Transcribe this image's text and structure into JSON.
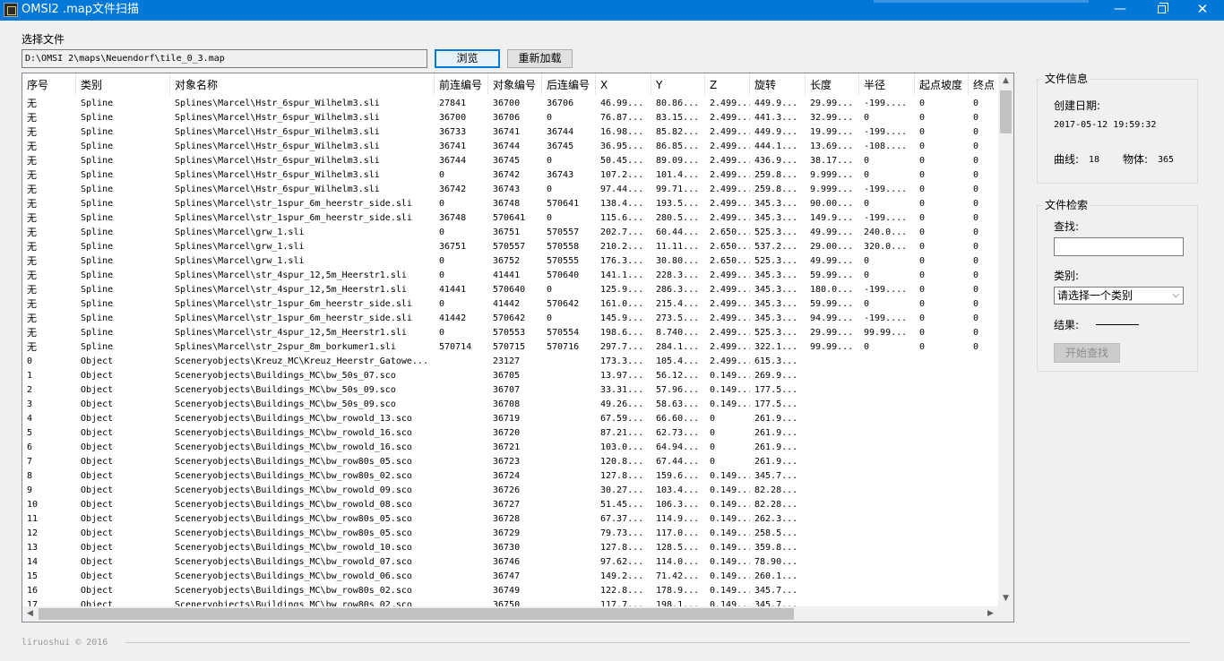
{
  "window": {
    "title": "OMSI2 .map文件扫描",
    "minimize": "—",
    "close": "✕"
  },
  "file": {
    "label": "选择文件",
    "path": "D:\\OMSI 2\\maps\\Neuendorf\\tile_0_3.map",
    "browse_label": "浏览",
    "reload_label": "重新加载"
  },
  "table": {
    "columns": [
      "序号",
      "类别",
      "对象名称",
      "前连编号",
      "对象编号",
      "后连编号",
      "X",
      "Y",
      "Z",
      "旋转",
      "长度",
      "半径",
      "起点坡度",
      "终点"
    ],
    "rows": [
      [
        "无",
        "Spline",
        "Splines\\Marcel\\Hstr_6spur_Wilhelm3.sli",
        "27841",
        "36700",
        "36706",
        "46.99...",
        "80.86...",
        "2.499...",
        "449.9...",
        "29.99...",
        "-199....",
        "0",
        "0"
      ],
      [
        "无",
        "Spline",
        "Splines\\Marcel\\Hstr_6spur_Wilhelm3.sli",
        "36700",
        "36706",
        "0",
        "76.87...",
        "83.15...",
        "2.499...",
        "441.3...",
        "32.99...",
        "0",
        "0",
        "0"
      ],
      [
        "无",
        "Spline",
        "Splines\\Marcel\\Hstr_6spur_Wilhelm3.sli",
        "36733",
        "36741",
        "36744",
        "16.98...",
        "85.82...",
        "2.499...",
        "449.9...",
        "19.99...",
        "-199....",
        "0",
        "0"
      ],
      [
        "无",
        "Spline",
        "Splines\\Marcel\\Hstr_6spur_Wilhelm3.sli",
        "36741",
        "36744",
        "36745",
        "36.95...",
        "86.85...",
        "2.499...",
        "444.1...",
        "13.69...",
        "-108....",
        "0",
        "0"
      ],
      [
        "无",
        "Spline",
        "Splines\\Marcel\\Hstr_6spur_Wilhelm3.sli",
        "36744",
        "36745",
        "0",
        "50.45...",
        "89.09...",
        "2.499...",
        "436.9...",
        "38.17...",
        "0",
        "0",
        "0"
      ],
      [
        "无",
        "Spline",
        "Splines\\Marcel\\Hstr_6spur_Wilhelm3.sli",
        "0",
        "36742",
        "36743",
        "107.2...",
        "101.4...",
        "2.499...",
        "259.8...",
        "9.999...",
        "0",
        "0",
        "0"
      ],
      [
        "无",
        "Spline",
        "Splines\\Marcel\\Hstr_6spur_Wilhelm3.sli",
        "36742",
        "36743",
        "0",
        "97.44...",
        "99.71...",
        "2.499...",
        "259.8...",
        "9.999...",
        "-199....",
        "0",
        "0"
      ],
      [
        "无",
        "Spline",
        "Splines\\Marcel\\str_1spur_6m_heerstr_side.sli",
        "0",
        "36748",
        "570641",
        "138.4...",
        "193.5...",
        "2.499...",
        "345.3...",
        "90.00...",
        "0",
        "0",
        "0"
      ],
      [
        "无",
        "Spline",
        "Splines\\Marcel\\str_1spur_6m_heerstr_side.sli",
        "36748",
        "570641",
        "0",
        "115.6...",
        "280.5...",
        "2.499...",
        "345.3...",
        "149.9...",
        "-199....",
        "0",
        "0"
      ],
      [
        "无",
        "Spline",
        "Splines\\Marcel\\grw_1.sli",
        "0",
        "36751",
        "570557",
        "202.7...",
        "60.44...",
        "2.650...",
        "525.3...",
        "49.99...",
        "240.0...",
        "0",
        "0"
      ],
      [
        "无",
        "Spline",
        "Splines\\Marcel\\grw_1.sli",
        "36751",
        "570557",
        "570558",
        "210.2...",
        "11.11...",
        "2.650...",
        "537.2...",
        "29.00...",
        "320.0...",
        "0",
        "0"
      ],
      [
        "无",
        "Spline",
        "Splines\\Marcel\\grw_1.sli",
        "0",
        "36752",
        "570555",
        "176.3...",
        "30.80...",
        "2.650...",
        "525.3...",
        "49.99...",
        "0",
        "0",
        "0"
      ],
      [
        "无",
        "Spline",
        "Splines\\Marcel\\str_4spur_12,5m_Heerstr1.sli",
        "0",
        "41441",
        "570640",
        "141.1...",
        "228.3...",
        "2.499...",
        "345.3...",
        "59.99...",
        "0",
        "0",
        "0"
      ],
      [
        "无",
        "Spline",
        "Splines\\Marcel\\str_4spur_12,5m_Heerstr1.sli",
        "41441",
        "570640",
        "0",
        "125.9...",
        "286.3...",
        "2.499...",
        "345.3...",
        "180.0...",
        "-199....",
        "0",
        "0"
      ],
      [
        "无",
        "Spline",
        "Splines\\Marcel\\str_1spur_6m_heerstr_side.sli",
        "0",
        "41442",
        "570642",
        "161.0...",
        "215.4...",
        "2.499...",
        "345.3...",
        "59.99...",
        "0",
        "0",
        "0"
      ],
      [
        "无",
        "Spline",
        "Splines\\Marcel\\str_1spur_6m_heerstr_side.sli",
        "41442",
        "570642",
        "0",
        "145.9...",
        "273.5...",
        "2.499...",
        "345.3...",
        "94.99...",
        "-199....",
        "0",
        "0"
      ],
      [
        "无",
        "Spline",
        "Splines\\Marcel\\str_4spur_12,5m_Heerstr1.sli",
        "0",
        "570553",
        "570554",
        "198.6...",
        "8.740...",
        "2.499...",
        "525.3...",
        "29.99...",
        "99.99...",
        "0",
        "0"
      ],
      [
        "无",
        "Spline",
        "Splines\\Marcel\\str_2spur_8m_borkumer1.sli",
        "570714",
        "570715",
        "570716",
        "297.7...",
        "284.1...",
        "2.499...",
        "322.1...",
        "99.99...",
        "0",
        "0",
        "0"
      ],
      [
        "0",
        "Object",
        "Sceneryobjects\\Kreuz_MC\\Kreuz_Heerstr_Gatowe...",
        "",
        "23127",
        "",
        "173.3...",
        "105.4...",
        "2.499...",
        "615.3...",
        "",
        "",
        "",
        ""
      ],
      [
        "1",
        "Object",
        "Sceneryobjects\\Buildings_MC\\bw_50s_07.sco",
        "",
        "36705",
        "",
        "13.97...",
        "56.12...",
        "0.149...",
        "269.9...",
        "",
        "",
        "",
        ""
      ],
      [
        "2",
        "Object",
        "Sceneryobjects\\Buildings_MC\\bw_50s_09.sco",
        "",
        "36707",
        "",
        "33.31...",
        "57.96...",
        "0.149...",
        "177.5...",
        "",
        "",
        "",
        ""
      ],
      [
        "3",
        "Object",
        "Sceneryobjects\\Buildings_MC\\bw_50s_09.sco",
        "",
        "36708",
        "",
        "49.26...",
        "58.63...",
        "0.149...",
        "177.5...",
        "",
        "",
        "",
        ""
      ],
      [
        "4",
        "Object",
        "Sceneryobjects\\Buildings_MC\\bw_rowold_13.sco",
        "",
        "36719",
        "",
        "67.59...",
        "66.60...",
        "0",
        "261.9...",
        "",
        "",
        "",
        ""
      ],
      [
        "5",
        "Object",
        "Sceneryobjects\\Buildings_MC\\bw_rowold_16.sco",
        "",
        "36720",
        "",
        "87.21...",
        "62.73...",
        "0",
        "261.9...",
        "",
        "",
        "",
        ""
      ],
      [
        "6",
        "Object",
        "Sceneryobjects\\Buildings_MC\\bw_rowold_16.sco",
        "",
        "36721",
        "",
        "103.0...",
        "64.94...",
        "0",
        "261.9...",
        "",
        "",
        "",
        ""
      ],
      [
        "7",
        "Object",
        "Sceneryobjects\\Buildings_MC\\bw_row80s_05.sco",
        "",
        "36723",
        "",
        "120.8...",
        "67.44...",
        "0",
        "261.9...",
        "",
        "",
        "",
        ""
      ],
      [
        "8",
        "Object",
        "Sceneryobjects\\Buildings_MC\\bw_row80s_02.sco",
        "",
        "36724",
        "",
        "127.8...",
        "159.6...",
        "0.149...",
        "345.7...",
        "",
        "",
        "",
        ""
      ],
      [
        "9",
        "Object",
        "Sceneryobjects\\Buildings_MC\\bw_rowold_09.sco",
        "",
        "36726",
        "",
        "30.27...",
        "103.4...",
        "0.149...",
        "82.28...",
        "",
        "",
        "",
        ""
      ],
      [
        "10",
        "Object",
        "Sceneryobjects\\Buildings_MC\\bw_rowold_08.sco",
        "",
        "36727",
        "",
        "51.45...",
        "106.3...",
        "0.149...",
        "82.28...",
        "",
        "",
        "",
        ""
      ],
      [
        "11",
        "Object",
        "Sceneryobjects\\Buildings_MC\\bw_row80s_05.sco",
        "",
        "36728",
        "",
        "67.37...",
        "114.9...",
        "0.149...",
        "262.3...",
        "",
        "",
        "",
        ""
      ],
      [
        "12",
        "Object",
        "Sceneryobjects\\Buildings_MC\\bw_row80s_05.sco",
        "",
        "36729",
        "",
        "79.73...",
        "117.0...",
        "0.149...",
        "258.5...",
        "",
        "",
        "",
        ""
      ],
      [
        "13",
        "Object",
        "Sceneryobjects\\Buildings_MC\\bw_rowold_10.sco",
        "",
        "36730",
        "",
        "127.8...",
        "128.5...",
        "0.149...",
        "359.8...",
        "",
        "",
        "",
        ""
      ],
      [
        "14",
        "Object",
        "Sceneryobjects\\Buildings_MC\\bw_rowold_07.sco",
        "",
        "36746",
        "",
        "97.62...",
        "114.0...",
        "0.149...",
        "78.90...",
        "",
        "",
        "",
        ""
      ],
      [
        "15",
        "Object",
        "Sceneryobjects\\Buildings_MC\\bw_rowold_06.sco",
        "",
        "36747",
        "",
        "149.2...",
        "71.42...",
        "0.149...",
        "260.1...",
        "",
        "",
        "",
        ""
      ],
      [
        "16",
        "Object",
        "Sceneryobjects\\Buildings_MC\\bw_row80s_02.sco",
        "",
        "36749",
        "",
        "122.8...",
        "178.9...",
        "0.149...",
        "345.7...",
        "",
        "",
        "",
        ""
      ],
      [
        "17",
        "Object",
        "Sceneryobjects\\Buildings_MC\\bw_row80s_02.sco",
        "",
        "36750",
        "",
        "117.7...",
        "198.1...",
        "0.149...",
        "345.7...",
        "",
        "",
        "",
        ""
      ]
    ]
  },
  "file_info": {
    "title": "文件信息",
    "created_label": "创建日期:",
    "created_value": "2017-05-12 19:59:32",
    "curves_label": "曲线:",
    "curves_value": "18",
    "objects_label": "物体:",
    "objects_value": "365"
  },
  "search": {
    "title": "文件检索",
    "find_label": "查找:",
    "find_value": "",
    "category_label": "类别:",
    "category_selected": "请选择一个类别",
    "result_label": "结果:",
    "start_label": "开始查找"
  },
  "footer": {
    "credit": "liruoshui © 2016"
  }
}
